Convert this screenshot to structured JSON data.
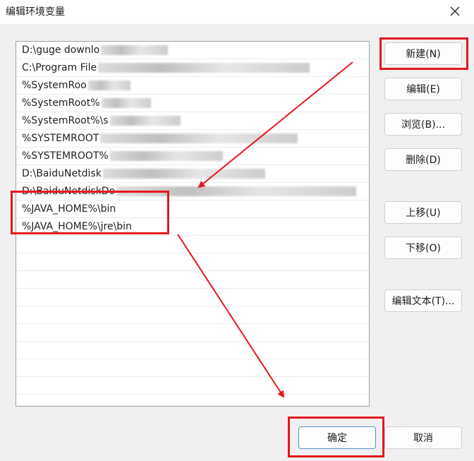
{
  "window": {
    "title": "编辑环境变量"
  },
  "paths": [
    {
      "text": "D:\\guge downlo"
    },
    {
      "text": "C:\\Program File"
    },
    {
      "text": "%SystemRoo"
    },
    {
      "text": "%SystemRoot%"
    },
    {
      "text": "%SystemRoot%\\s"
    },
    {
      "text": "%SYSTEMROOT"
    },
    {
      "text": "%SYSTEMROOT%"
    },
    {
      "text": "D:\\BaiduNetdisk"
    },
    {
      "text": "D:\\BaiduNetdiskDo"
    },
    {
      "text": "%JAVA_HOME%\\bin"
    },
    {
      "text": "%JAVA_HOME%\\jre\\bin"
    }
  ],
  "buttons": {
    "new": "新建(N)",
    "edit": "编辑(E)",
    "browse": "浏览(B)...",
    "delete": "删除(D)",
    "move_up": "上移(U)",
    "move_down": "下移(O)",
    "edit_text": "编辑文本(T)...",
    "ok": "确定",
    "cancel": "取消"
  },
  "colors": {
    "annotation": "#e8161c",
    "accent": "#5a8fd0"
  }
}
